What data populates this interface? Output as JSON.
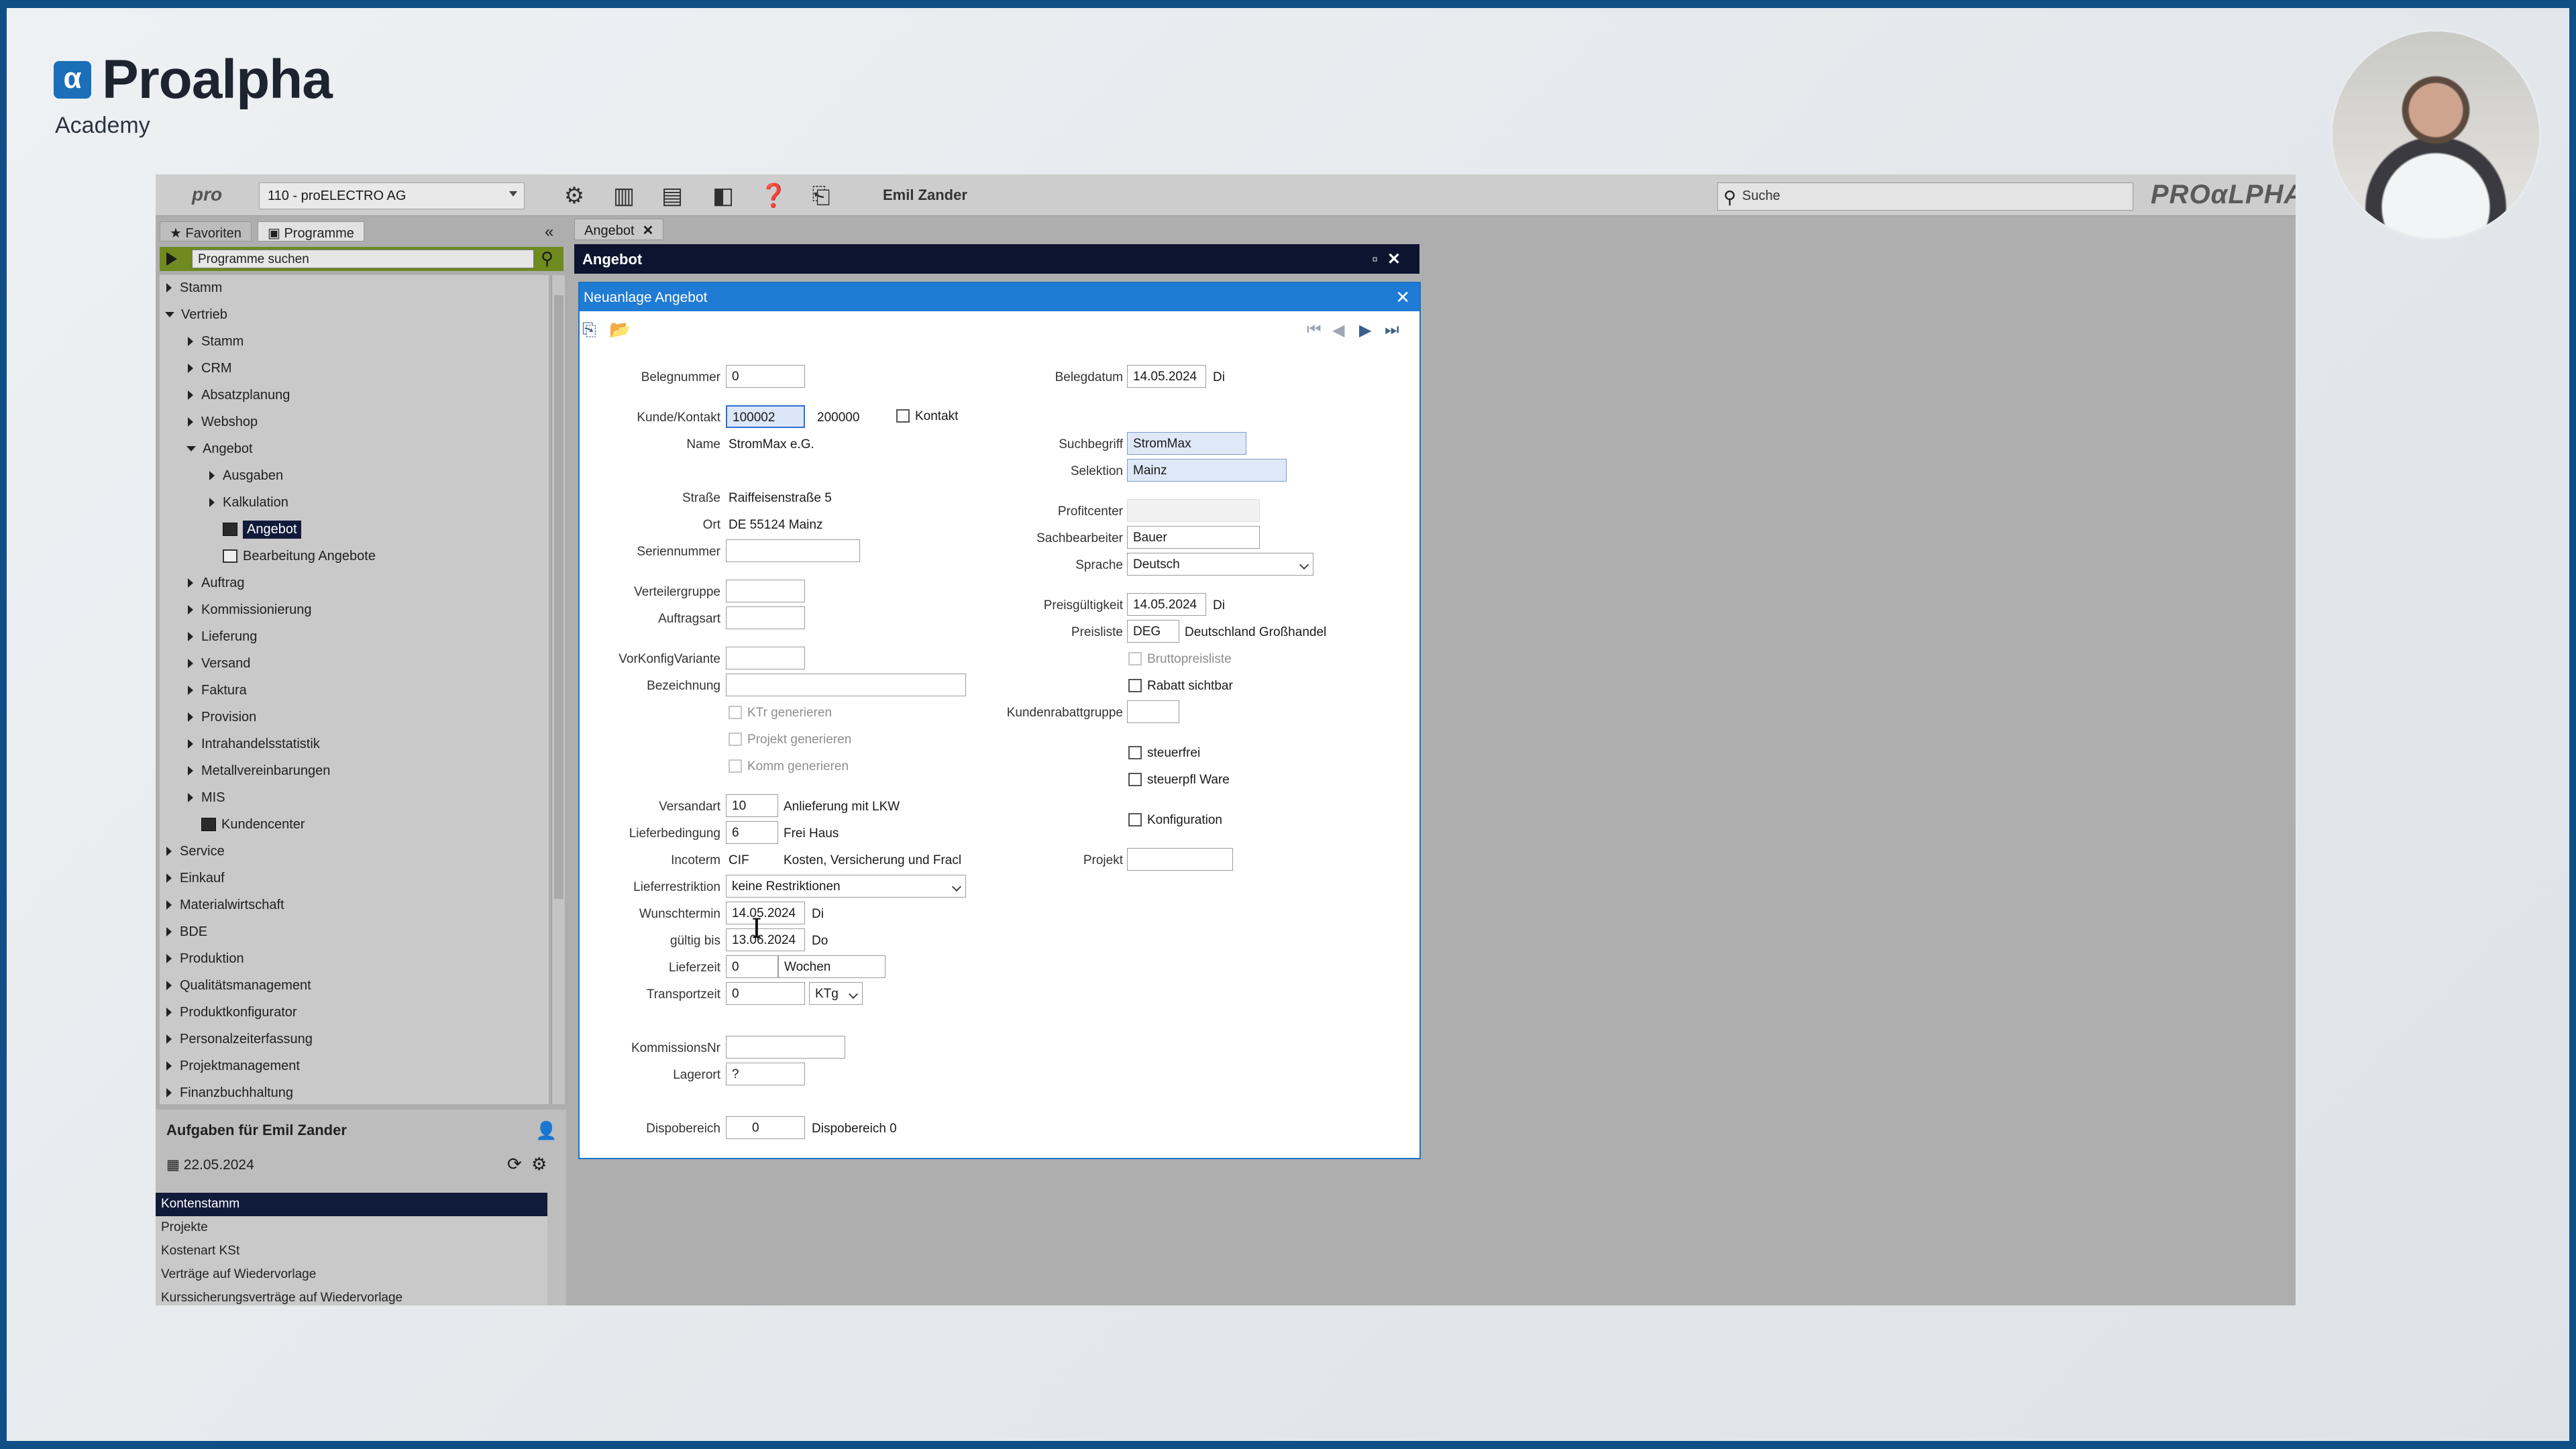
{
  "brand": {
    "name": "Proalpha",
    "sub": "Academy",
    "mark": "α"
  },
  "topbar": {
    "pro_logo": "pro",
    "company": "110 - proELECTRO AG",
    "user": "Emil Zander",
    "search_placeholder": "Suche",
    "logo": "PROαLPHA"
  },
  "navtabs": {
    "favorites": "Favoriten",
    "programs": "Programme"
  },
  "prog_search": {
    "placeholder": "Programme suchen"
  },
  "tree": [
    {
      "label": "Stamm"
    },
    {
      "label": "Vertrieb"
    },
    {
      "label": "Stamm"
    },
    {
      "label": "CRM"
    },
    {
      "label": "Absatzplanung"
    },
    {
      "label": "Webshop"
    },
    {
      "label": "Angebot"
    },
    {
      "label": "Ausgaben"
    },
    {
      "label": "Kalkulation"
    },
    {
      "label": "Angebot"
    },
    {
      "label": "Bearbeitung Angebote"
    },
    {
      "label": "Auftrag"
    },
    {
      "label": "Kommissionierung"
    },
    {
      "label": "Lieferung"
    },
    {
      "label": "Versand"
    },
    {
      "label": "Faktura"
    },
    {
      "label": "Provision"
    },
    {
      "label": "Intrahandelsstatistik"
    },
    {
      "label": "Metallvereinbarungen"
    },
    {
      "label": "MIS"
    },
    {
      "label": "Kundencenter"
    },
    {
      "label": "Service"
    },
    {
      "label": "Einkauf"
    },
    {
      "label": "Materialwirtschaft"
    },
    {
      "label": "BDE"
    },
    {
      "label": "Produktion"
    },
    {
      "label": "Qualitätsmanagement"
    },
    {
      "label": "Produktkonfigurator"
    },
    {
      "label": "Personalzeiterfassung"
    },
    {
      "label": "Projektmanagement"
    },
    {
      "label": "Finanzbuchhaltung"
    }
  ],
  "tasks": {
    "title": "Aufgaben für Emil Zander",
    "date": "22.05.2024",
    "items": [
      "Kontenstamm",
      "Projekte",
      "Kostenart KSt",
      "Verträge auf Wiedervorlage",
      "Kurssicherungsverträge auf Wiedervorlage"
    ]
  },
  "mdi": {
    "tab": "Angebot",
    "window_title": "Angebot"
  },
  "dialog": {
    "title": "Neuanlage Angebot",
    "left": {
      "belegnummer_label": "Belegnummer",
      "belegnummer": "0",
      "kunde_label": "Kunde/Kontakt",
      "kunde": "100002",
      "kontakt_nr": "200000",
      "kontakt_check": "Kontakt",
      "name_label": "Name",
      "name": "StromMax e.G.",
      "strasse_label": "Straße",
      "strasse": "Raiffeisenstraße 5",
      "ort_label": "Ort",
      "ort": "DE 55124 Mainz",
      "serien_label": "Seriennummer",
      "serien": "",
      "verteiler_label": "Verteilergruppe",
      "verteiler": "",
      "auftragsart_label": "Auftragsart",
      "auftragsart": "",
      "vorkonfig_label": "VorKonfigVariante",
      "vorkonfig": "",
      "bezeichnung_label": "Bezeichnung",
      "bezeichnung": "",
      "ktr": "KTr generieren",
      "projekt_gen": "Projekt generieren",
      "komm_gen": "Komm generieren",
      "versandart_label": "Versandart",
      "versandart": "10",
      "versandart_text": "Anlieferung mit LKW",
      "lieferbed_label": "Lieferbedingung",
      "lieferbed": "6",
      "lieferbed_text": "Frei Haus",
      "incoterm_label": "Incoterm",
      "incoterm": "CIF",
      "incoterm_text": "Kosten, Versicherung und Fracl",
      "lieferrestr_label": "Lieferrestriktion",
      "lieferrestr": "keine Restriktionen",
      "wunsch_label": "Wunschtermin",
      "wunsch": "14.05.2024",
      "wunsch_day": "Di",
      "gueltig_label": "gültig bis",
      "gueltig": "13.06.2024",
      "gueltig_day": "Do",
      "lieferzeit_label": "Lieferzeit",
      "lieferzeit": "0",
      "lieferzeit_unit": "Wochen",
      "transport_label": "Transportzeit",
      "transport": "0",
      "transport_unit": "KTg",
      "kommnr_label": "KommissionsNr",
      "kommnr": "",
      "lagerort_label": "Lagerort",
      "lagerort": "?",
      "dispo_label": "Dispobereich",
      "dispo": "0",
      "dispo_text": "Dispobereich 0"
    },
    "right": {
      "belegdatum_label": "Belegdatum",
      "belegdatum": "14.05.2024",
      "belegdatum_day": "Di",
      "suchbegriff_label": "Suchbegriff",
      "suchbegriff": "StromMax",
      "selektion_label": "Selektion",
      "selektion": "Mainz",
      "profit_label": "Profitcenter",
      "profit": "",
      "sachb_label": "Sachbearbeiter",
      "sachb": "Bauer",
      "sprache_label": "Sprache",
      "sprache": "Deutsch",
      "preisg_label": "Preisgültigkeit",
      "preisg": "14.05.2024",
      "preisg_day": "Di",
      "preisliste_label": "Preisliste",
      "preisliste": "DEG",
      "preisliste_text": "Deutschland Großhandel",
      "brutto": "Bruttopreisliste",
      "rabatt": "Rabatt sichtbar",
      "kundenrabatt_label": "Kundenrabattgruppe",
      "kundenrabatt": "",
      "steuerfrei": "steuerfrei",
      "steuerpfl": "steuerpfl Ware",
      "konfig": "Konfiguration",
      "projekt_label": "Projekt",
      "projekt": ""
    }
  }
}
